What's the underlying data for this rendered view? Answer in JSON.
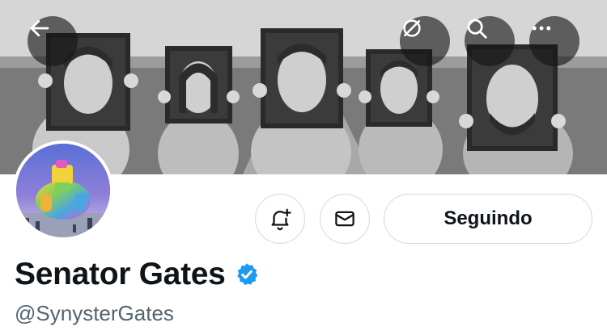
{
  "profile": {
    "display_name": "Senator Gates",
    "handle": "@SynysterGates",
    "verified": true
  },
  "actions": {
    "following_label": "Seguindo"
  },
  "icons": {
    "back": "arrow-left-icon",
    "translate": "translate-off-icon",
    "search": "search-icon",
    "more": "more-icon",
    "notify": "bell-plus-icon",
    "message": "envelope-icon",
    "verified": "verified-badge-icon"
  },
  "colors": {
    "verified_blue": "#1d9bf0",
    "text_primary": "#0f1419",
    "text_secondary": "#536471",
    "border": "#cfd9de"
  }
}
